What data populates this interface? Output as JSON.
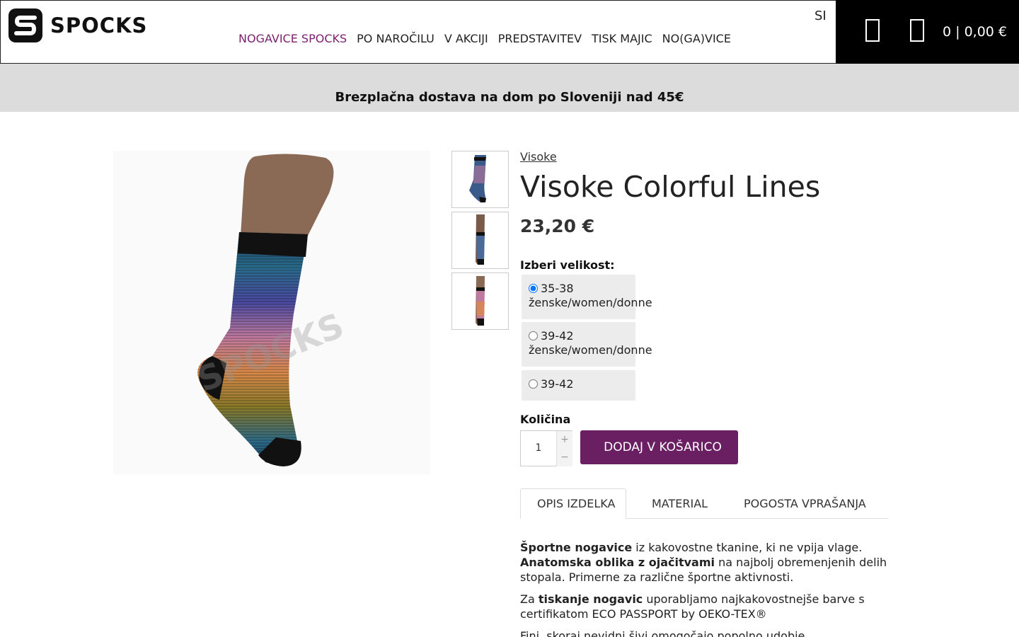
{
  "header": {
    "logo_text": "SPOCKS",
    "nav": [
      {
        "label": "NOGAVICE SPOCKS",
        "active": true
      },
      {
        "label": "PO NAROČILU",
        "active": false
      },
      {
        "label": "V AKCIJI",
        "active": false
      },
      {
        "label": "PREDSTAVITEV",
        "active": false
      },
      {
        "label": "TISK MAJIC",
        "active": false
      },
      {
        "label": "NO(GA)VICE",
        "active": false
      }
    ],
    "language": "SI",
    "icons": [
      "user-icon",
      "cart-icon"
    ],
    "cart_summary": "0 | 0,00 €"
  },
  "announcement": {
    "text": " Brezplačna dostava na dom po Sloveniji nad 45€ "
  },
  "product": {
    "category": "Visoke",
    "title": "Visoke Colorful Lines",
    "price": "23,20 €",
    "size_label": "Izberi velikost:",
    "sizes": [
      {
        "line1": "35-38",
        "line2": "ženske/women/donne",
        "selected": true
      },
      {
        "line1": "39-42",
        "line2": "ženske/women/donne",
        "selected": false
      },
      {
        "line1": "39-42",
        "line2": "",
        "selected": false
      }
    ],
    "quantity_label": "Količina",
    "quantity": "1",
    "qty_plus": "+",
    "qty_minus": "−",
    "add_to_cart": "DODAJ V KOŠARICO",
    "add_icon": ""
  },
  "tabs": [
    {
      "icon": "",
      "label": "OPIS IZDELKA",
      "active": true
    },
    {
      "icon": "",
      "label": "MATERIAL",
      "active": false
    },
    {
      "icon": "",
      "label": "POGOSTA VPRAŠANJA",
      "active": false
    }
  ],
  "description": {
    "p1_b1": "Športne nogavice",
    "p1_t1": " iz kakovostne tkanine, ki ne vpija vlage. ",
    "p1_b2": "Anatomska oblika z ojačitvami",
    "p1_t2": " na najbolj obremenjenih delih stopala. Primerne za različne športne aktivnosti.",
    "p2_t1": "Za ",
    "p2_b1": "tiskanje nogavic",
    "p2_t2": " uporabljamo najkakovostnejše barve s certifikatom ECO PASSPORT by OEKO-TEX®",
    "p3": "Fini, skoraj nevidni šivi omogočajo popolno udobje."
  },
  "colors": {
    "accent": "#6b1f63",
    "nav_active": "#7b1f6e",
    "announce_bg": "#dcdcdc",
    "header_dark": "#000000"
  }
}
